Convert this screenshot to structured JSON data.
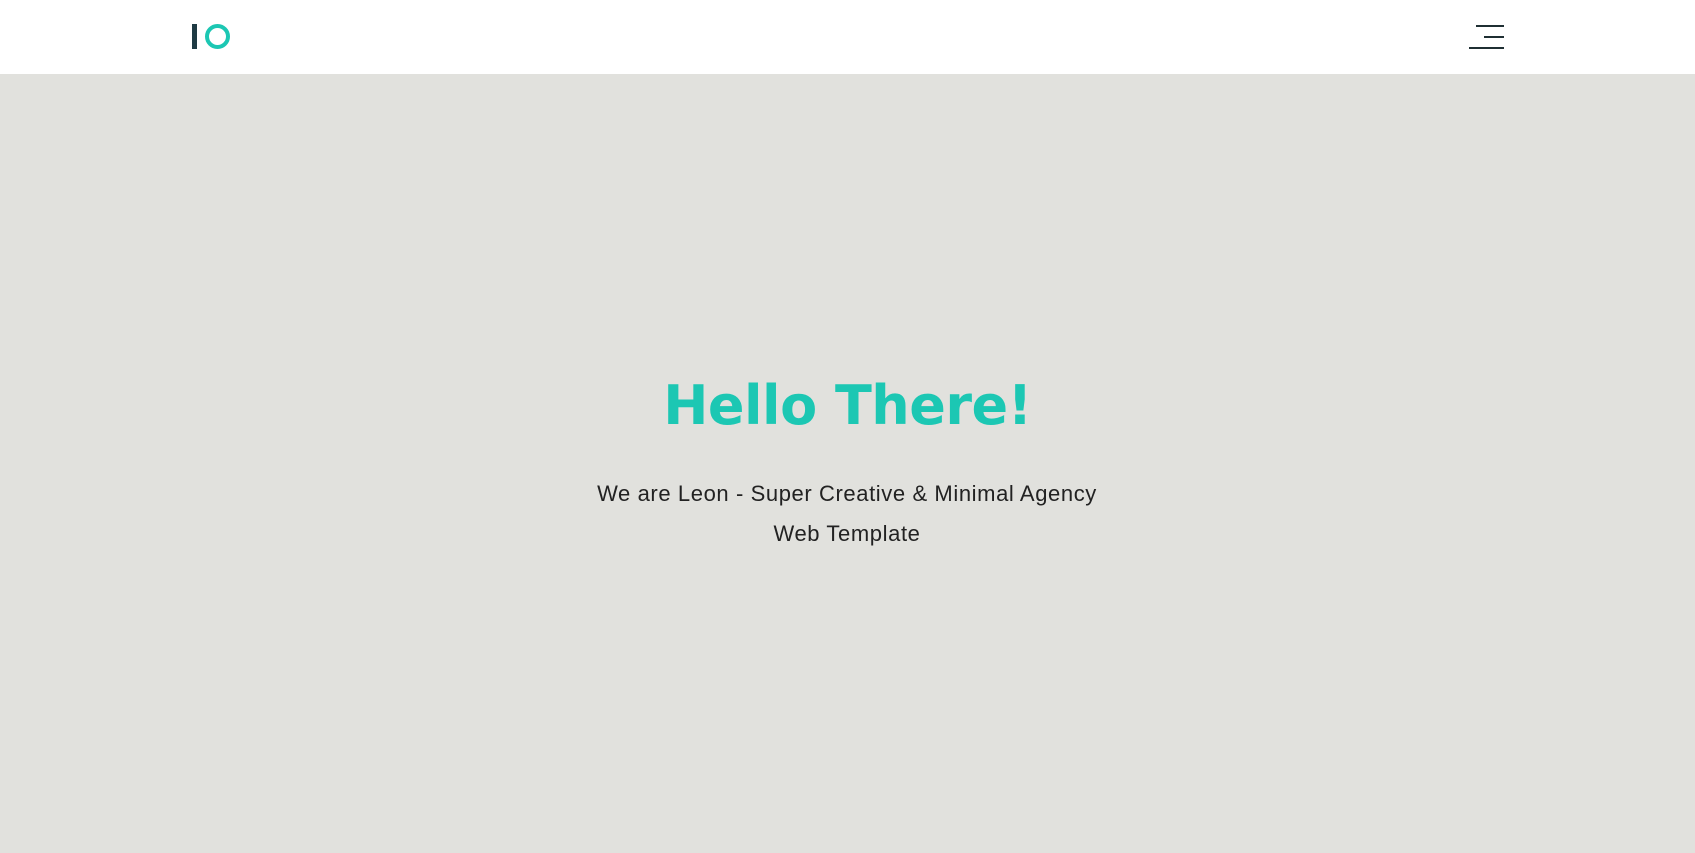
{
  "header": {
    "logo_icon": "io-logo-icon",
    "menu_icon": "hamburger-menu-icon"
  },
  "hero": {
    "title": "Hello There!",
    "subtitle": "We are Leon - Super Creative & Minimal Agency Web Template"
  },
  "colors": {
    "accent": "#1cc7b3",
    "logo_dark": "#1f3b44",
    "hero_background": "#e1e1dd",
    "header_background": "#ffffff",
    "text": "#222222"
  }
}
